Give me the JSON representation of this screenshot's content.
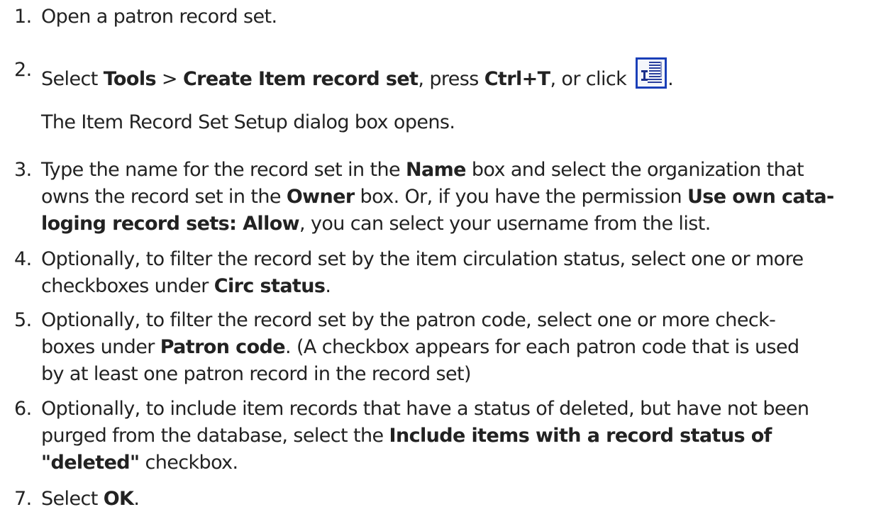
{
  "steps": [
    {
      "num": "1.",
      "segments": [
        {
          "t": "Open a patron record set.",
          "b": false
        }
      ]
    },
    {
      "num": "2.",
      "segments": [
        {
          "t": "Select ",
          "b": false
        },
        {
          "t": "Tools",
          "b": true
        },
        {
          "t": " > ",
          "b": false
        },
        {
          "t": "Create Item record set",
          "b": true
        },
        {
          "t": ", press ",
          "b": false
        },
        {
          "t": "Ctrl+T",
          "b": true
        },
        {
          "t": ", or click ",
          "b": false
        },
        {
          "icon": "create-item-record-set-icon"
        },
        {
          "t": ".",
          "b": false
        }
      ],
      "note": "The Item Record Set Setup dialog box opens."
    },
    {
      "num": "3.",
      "lines": [
        [
          {
            "t": "Type the name for the record set in the ",
            "b": false
          },
          {
            "t": "Name",
            "b": true
          },
          {
            "t": " box and select the organization that",
            "b": false
          }
        ],
        [
          {
            "t": "owns the record set in the ",
            "b": false
          },
          {
            "t": "Owner",
            "b": true
          },
          {
            "t": " box. Or, if you have the permission ",
            "b": false
          },
          {
            "t": "Use own cata-",
            "b": true
          }
        ],
        [
          {
            "t": "loging record sets: Allow",
            "b": true
          },
          {
            "t": ", you can select your username from the list.",
            "b": false
          }
        ]
      ]
    },
    {
      "num": "4.",
      "lines": [
        [
          {
            "t": "Optionally, to filter the record set by the item circulation status, select one or more",
            "b": false
          }
        ],
        [
          {
            "t": "checkboxes under ",
            "b": false
          },
          {
            "t": "Circ status",
            "b": true
          },
          {
            "t": ".",
            "b": false
          }
        ]
      ]
    },
    {
      "num": "5.",
      "lines": [
        [
          {
            "t": "Optionally, to filter the record set by the patron code, select one or more check-",
            "b": false
          }
        ],
        [
          {
            "t": "boxes under ",
            "b": false
          },
          {
            "t": "Patron code",
            "b": true
          },
          {
            "t": ". (A checkbox appears for each patron code that is used",
            "b": false
          }
        ],
        [
          {
            "t": "by at least one patron record in the record set)",
            "b": false
          }
        ]
      ]
    },
    {
      "num": "6.",
      "lines": [
        [
          {
            "t": "Optionally, to include item records that have a status of deleted, but have not been",
            "b": false
          }
        ],
        [
          {
            "t": "purged from the database, select the ",
            "b": false
          },
          {
            "t": "Include items with a record status of",
            "b": true
          }
        ],
        [
          {
            "t": "\"deleted\"",
            "b": true
          },
          {
            "t": " checkbox.",
            "b": false
          }
        ]
      ]
    },
    {
      "num": "7.",
      "lines": [
        [
          {
            "t": "Select ",
            "b": false
          },
          {
            "t": "OK",
            "b": true
          },
          {
            "t": ".",
            "b": false
          }
        ]
      ]
    }
  ]
}
